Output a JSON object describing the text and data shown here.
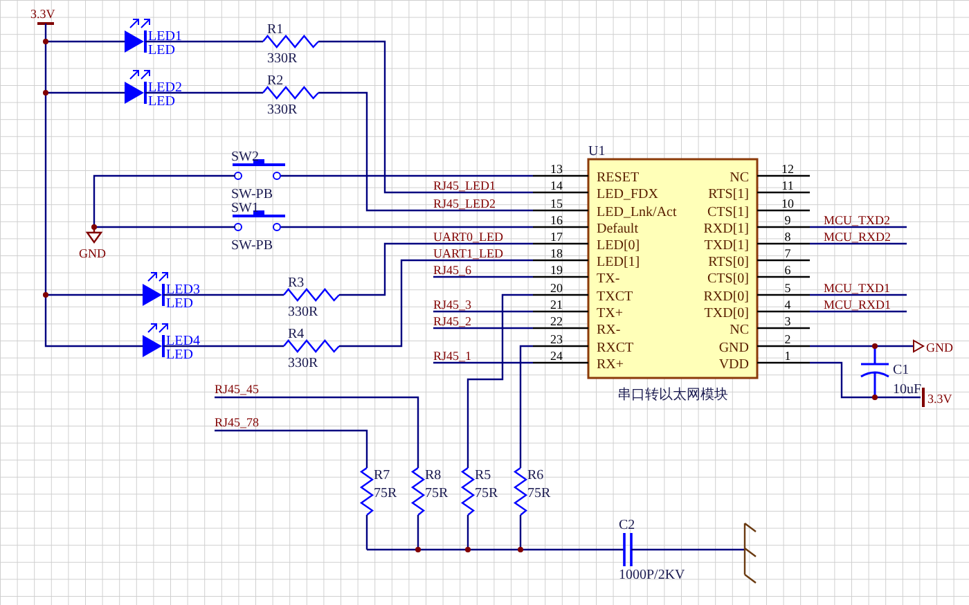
{
  "power_label": "3.3V",
  "gnd_label": "GND",
  "leds": [
    {
      "ref": "LED1",
      "value": "LED"
    },
    {
      "ref": "LED2",
      "value": "LED"
    },
    {
      "ref": "LED3",
      "value": "LED"
    },
    {
      "ref": "LED4",
      "value": "LED"
    }
  ],
  "led_resistors": [
    {
      "ref": "R1",
      "value": "330R"
    },
    {
      "ref": "R2",
      "value": "330R"
    },
    {
      "ref": "R3",
      "value": "330R"
    },
    {
      "ref": "R4",
      "value": "330R"
    }
  ],
  "switches": [
    {
      "ref": "SW2",
      "value": "SW-PB"
    },
    {
      "ref": "SW1",
      "value": "SW-PB"
    }
  ],
  "left_nets": [
    "RJ45_LED1",
    "RJ45_LED2",
    "UART0_LED",
    "UART1_LED",
    "RJ45_6",
    "RJ45_3",
    "RJ45_2",
    "RJ45_1"
  ],
  "u1": {
    "ref": "U1",
    "caption": "串口转以太网模块",
    "left_pins": [
      {
        "number": "13",
        "name": "RESET"
      },
      {
        "number": "14",
        "name": "LED_FDX"
      },
      {
        "number": "15",
        "name": "LED_Lnk/Act"
      },
      {
        "number": "16",
        "name": "Default"
      },
      {
        "number": "17",
        "name": "LED[0]"
      },
      {
        "number": "18",
        "name": "LED[1]"
      },
      {
        "number": "19",
        "name": "TX-"
      },
      {
        "number": "20",
        "name": "TXCT"
      },
      {
        "number": "21",
        "name": "TX+"
      },
      {
        "number": "22",
        "name": "RX-"
      },
      {
        "number": "23",
        "name": "RXCT"
      },
      {
        "number": "24",
        "name": "RX+"
      }
    ],
    "right_pins": [
      {
        "number": "12",
        "name": "NC"
      },
      {
        "number": "11",
        "name": "RTS[1]"
      },
      {
        "number": "10",
        "name": "CTS[1]"
      },
      {
        "number": "9",
        "name": "RXD[1]"
      },
      {
        "number": "8",
        "name": "TXD[1]"
      },
      {
        "number": "7",
        "name": "RTS[0]"
      },
      {
        "number": "6",
        "name": "CTS[0]"
      },
      {
        "number": "5",
        "name": "RXD[0]"
      },
      {
        "number": "4",
        "name": "TXD[0]"
      },
      {
        "number": "3",
        "name": "NC"
      },
      {
        "number": "2",
        "name": "GND"
      },
      {
        "number": "1",
        "name": "VDD"
      }
    ]
  },
  "right_nets": [
    "MCU_TXD2",
    "MCU_RXD2",
    "MCU_TXD1",
    "MCU_RXD1"
  ],
  "c1": {
    "ref": "C1",
    "value": "10uF"
  },
  "gnd_port": "GND",
  "vdd_port": "3.3V",
  "termination_nets": [
    "RJ45_45",
    "RJ45_78"
  ],
  "termination_resistors": [
    {
      "ref": "R7",
      "value": "75R"
    },
    {
      "ref": "R8",
      "value": "75R"
    },
    {
      "ref": "R5",
      "value": "75R"
    },
    {
      "ref": "R6",
      "value": "75R"
    }
  ],
  "c2": {
    "ref": "C2",
    "value": "1000P/2KV"
  }
}
